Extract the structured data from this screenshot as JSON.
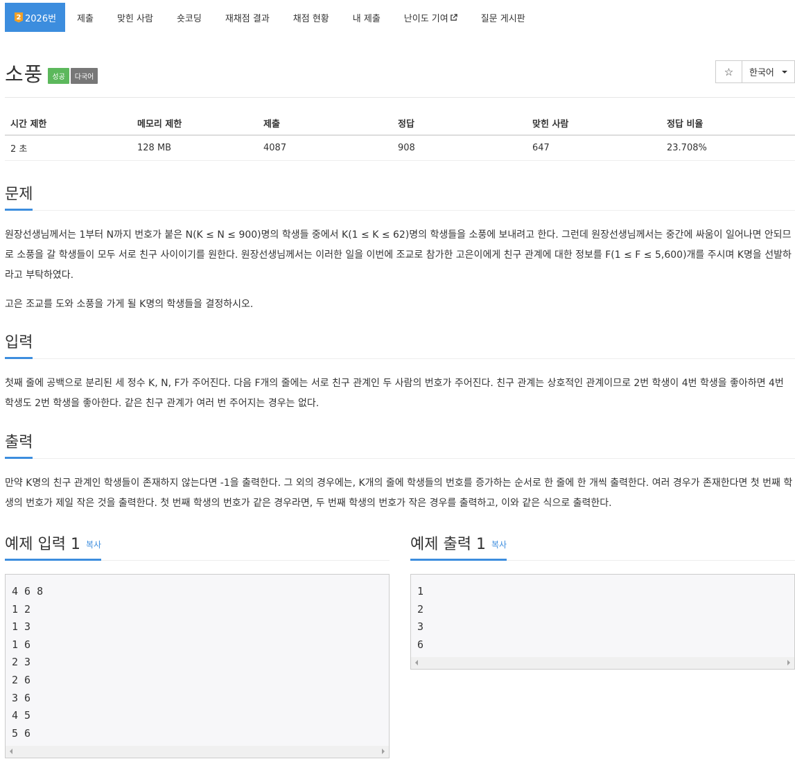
{
  "nav": {
    "tabs": [
      {
        "label": "2026번",
        "tier": "2"
      },
      {
        "label": "제출"
      },
      {
        "label": "맞힌 사람"
      },
      {
        "label": "숏코딩"
      },
      {
        "label": "재채점 결과"
      },
      {
        "label": "채점 현황"
      },
      {
        "label": "내 제출"
      },
      {
        "label": "난이도 기여"
      },
      {
        "label": "질문 게시판"
      }
    ]
  },
  "problem": {
    "title": "소풍",
    "badges": [
      "성공",
      "다국어"
    ],
    "language": "한국어",
    "star_icon": "star-icon",
    "colors": {
      "accent": "#3c8dde",
      "success": "#5cb85c",
      "gray": "#777777",
      "tier": "#f0a028"
    }
  },
  "stats": {
    "headers": [
      "시간 제한",
      "메모리 제한",
      "제출",
      "정답",
      "맞힌 사람",
      "정답 비율"
    ],
    "values": [
      "2 초",
      "128 MB",
      "4087",
      "908",
      "647",
      "23.708%"
    ]
  },
  "sections": {
    "problem": {
      "heading": "문제",
      "paragraphs": [
        "원장선생님께서는 1부터 N까지 번호가 붙은 N(K ≤ N ≤ 900)명의 학생들 중에서 K(1 ≤ K ≤ 62)명의 학생들을 소풍에 보내려고 한다. 그런데 원장선생님께서는 중간에 싸움이 일어나면 안되므로 소풍을 갈 학생들이 모두 서로 친구 사이이기를 원한다. 원장선생님께서는 이러한 일을 이번에 조교로 참가한 고은이에게 친구 관계에 대한 정보를 F(1 ≤ F ≤ 5,600)개를 주시며 K명을 선발하라고 부탁하였다.",
        "고은 조교를 도와 소풍을 가게 될 K명의 학생들을 결정하시오."
      ]
    },
    "input": {
      "heading": "입력",
      "text": "첫째 줄에 공백으로 분리된 세 정수 K, N, F가 주어진다. 다음 F개의 줄에는 서로 친구 관계인 두 사람의 번호가 주어진다. 친구 관계는 상호적인 관계이므로 2번 학생이 4번 학생을 좋아하면 4번 학생도 2번 학생을 좋아한다. 같은 친구 관계가 여러 번 주어지는 경우는 없다."
    },
    "output": {
      "heading": "출력",
      "text": "만약 K명의 친구 관계인 학생들이 존재하지 않는다면 -1을 출력한다. 그 외의 경우에는, K개의 줄에 학생들의 번호를 증가하는 순서로 한 줄에 한 개씩 출력한다. 여러 경우가 존재한다면 첫 번째 학생의 번호가 제일 작은 것을 출력한다. 첫 번째 학생의 번호가 같은 경우라면, 두 번째 학생의 번호가 작은 경우를 출력하고, 이와 같은 식으로 출력한다."
    },
    "sample_input": {
      "heading": "예제 입력 1",
      "copy": "복사",
      "lines": [
        "4 6 8",
        "1 2",
        "1 3",
        "1 6",
        "2 3",
        "2 6",
        "3 6",
        "4 5",
        "5 6"
      ]
    },
    "sample_output": {
      "heading": "예제 출력 1",
      "copy": "복사",
      "lines": [
        "1",
        "2",
        "3",
        "6"
      ]
    }
  }
}
